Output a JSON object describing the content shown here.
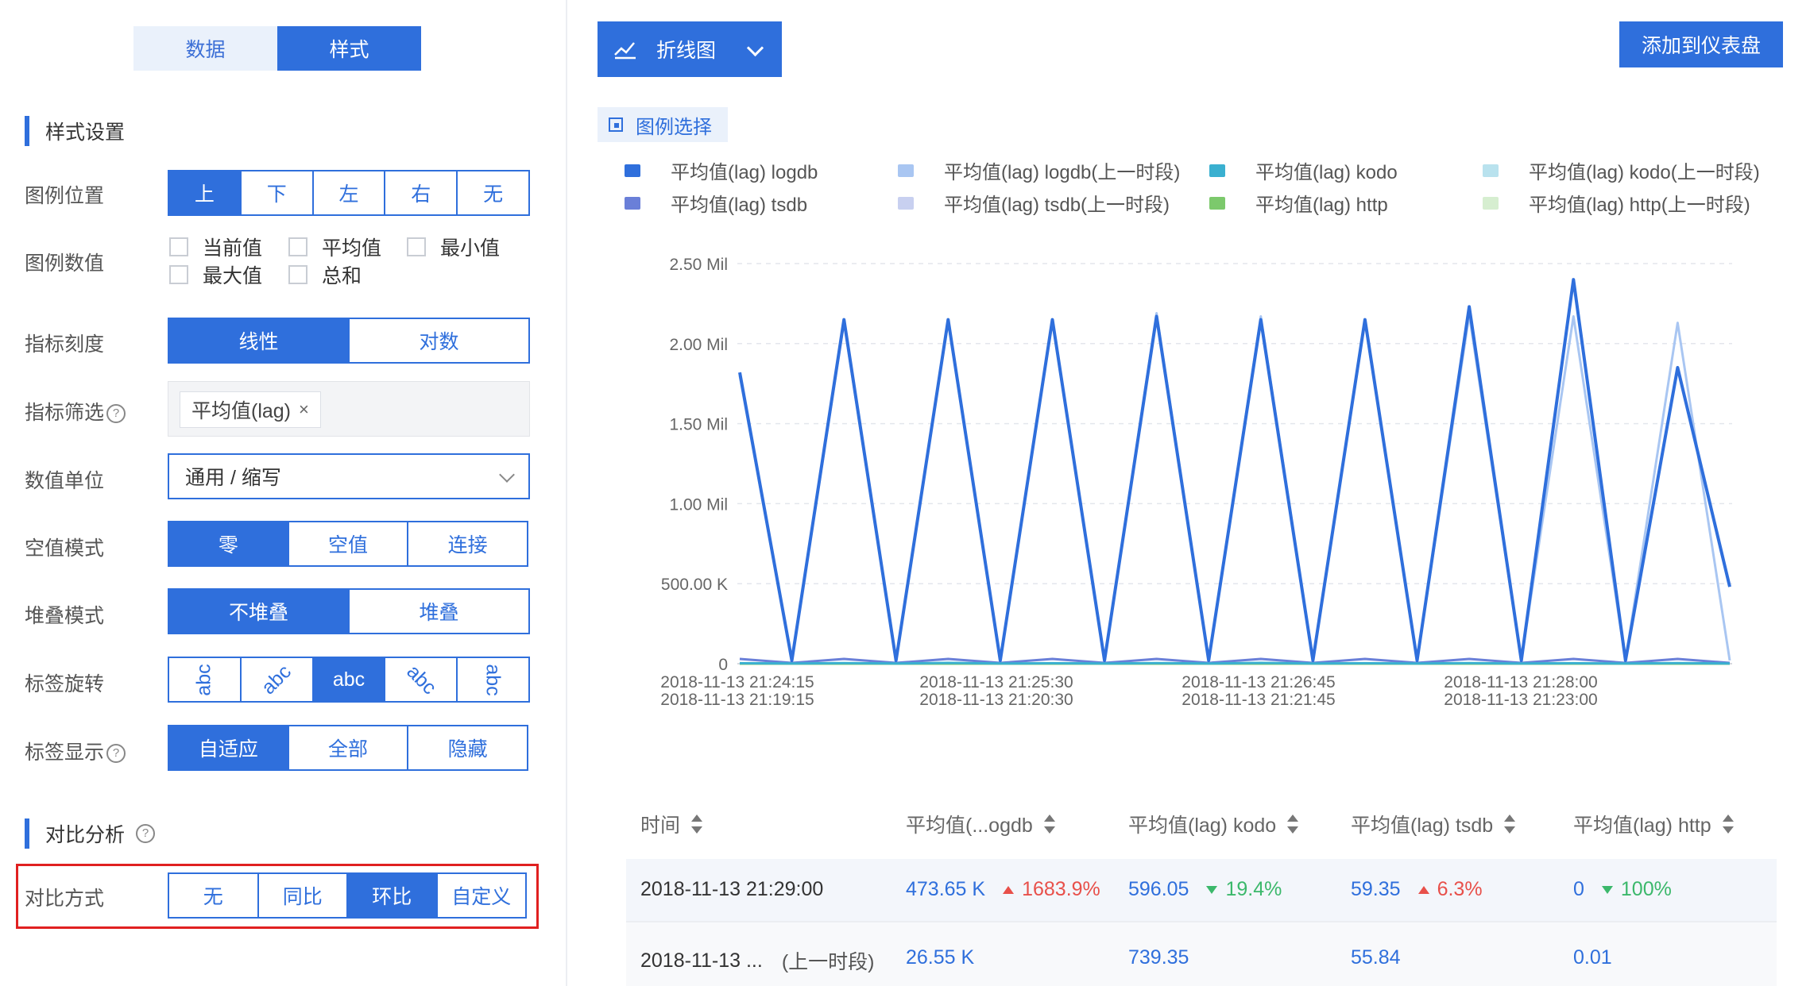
{
  "tabs": {
    "data": "数据",
    "style": "样式"
  },
  "style_section": {
    "title": "样式设置",
    "legend_position": {
      "label": "图例位置",
      "options": [
        "上",
        "下",
        "左",
        "右",
        "无"
      ],
      "selected": "上"
    },
    "legend_values": {
      "label": "图例数值",
      "options": [
        "当前值",
        "平均值",
        "最小值",
        "最大值",
        "总和"
      ]
    },
    "scale": {
      "label": "指标刻度",
      "options": [
        "线性",
        "对数"
      ],
      "selected": "线性"
    },
    "metric_filter": {
      "label": "指标筛选",
      "tag": "平均值(lag)",
      "tag_remove": "×"
    },
    "unit": {
      "label": "数值单位",
      "value": "通用 / 缩写"
    },
    "null_mode": {
      "label": "空值模式",
      "options": [
        "零",
        "空值",
        "连接"
      ],
      "selected": "零"
    },
    "stack_mode": {
      "label": "堆叠模式",
      "options": [
        "不堆叠",
        "堆叠"
      ],
      "selected": "不堆叠"
    },
    "label_rotate": {
      "label": "标签旋转",
      "options": [
        "abc",
        "abc",
        "abc",
        "abc",
        "abc"
      ],
      "selected_index": 2
    },
    "label_display": {
      "label": "标签显示",
      "options": [
        "自适应",
        "全部",
        "隐藏"
      ],
      "selected": "自适应"
    }
  },
  "compare_section": {
    "title": "对比分析",
    "mode": {
      "label": "对比方式",
      "options": [
        "无",
        "同比",
        "环比",
        "自定义"
      ],
      "selected": "环比"
    }
  },
  "help_glyph": "?",
  "toolbar": {
    "chart_type": "折线图",
    "add_button": "添加到仪表盘",
    "legend_select": "图例选择"
  },
  "legend": [
    {
      "label": "平均值(lag) logdb",
      "color": "#2f6fdc"
    },
    {
      "label": "平均值(lag) logdb(上一时段)",
      "color": "#a9c6f2"
    },
    {
      "label": "平均值(lag) kodo",
      "color": "#3ab0d0"
    },
    {
      "label": "平均值(lag) kodo(上一时段)",
      "color": "#b9e2ee"
    },
    {
      "label": "平均值(lag) tsdb",
      "color": "#6a7fd8"
    },
    {
      "label": "平均值(lag) tsdb(上一时段)",
      "color": "#c8d0f0"
    },
    {
      "label": "平均值(lag) http",
      "color": "#7cc96c"
    },
    {
      "label": "平均值(lag) http(上一时段)",
      "color": "#d6eed0"
    }
  ],
  "chart_data": {
    "type": "line",
    "y_ticks": [
      "2.50 Mil",
      "2.00 Mil",
      "1.50 Mil",
      "1.00 Mil",
      "500.00 K",
      "0"
    ],
    "ylim": [
      0,
      2500000
    ],
    "x_ticks": [
      {
        "top": "2018-11-13 21:24:15",
        "bottom": "2018-11-13 21:19:15"
      },
      {
        "top": "2018-11-13 21:25:30",
        "bottom": "2018-11-13 21:20:30"
      },
      {
        "top": "2018-11-13 21:26:45",
        "bottom": "2018-11-13 21:21:45"
      },
      {
        "top": "2018-11-13 21:28:00",
        "bottom": "2018-11-13 21:23:00"
      }
    ],
    "series": [
      {
        "name": "平均值(lag) logdb",
        "color": "#2f6fdc",
        "values": [
          1820000,
          20000,
          2150000,
          20000,
          2150000,
          20000,
          2150000,
          20000,
          2170000,
          20000,
          2150000,
          20000,
          2150000,
          20000,
          2230000,
          20000,
          2400000,
          20000,
          1850000,
          480000
        ]
      },
      {
        "name": "平均值(lag) logdb(上一时段)",
        "color": "#a9c6f2",
        "values": [
          1800000,
          20000,
          2130000,
          20000,
          2140000,
          20000,
          2140000,
          20000,
          2190000,
          20000,
          2170000,
          20000,
          2140000,
          20000,
          2180000,
          20000,
          2170000,
          20000,
          2130000,
          20000
        ]
      },
      {
        "name": "平均值(lag) kodo",
        "color": "#3ab0d0",
        "values": [
          3000,
          1000,
          4000,
          1000,
          5000,
          1000,
          3000,
          1000,
          4000,
          1000,
          5000,
          1000,
          3000,
          1000,
          4000,
          1000,
          3000,
          1000,
          4000,
          1000
        ]
      },
      {
        "name": "平均值(lag) tsdb",
        "color": "#6a7fd8",
        "values": [
          30000,
          5000,
          30000,
          5000,
          30000,
          5000,
          30000,
          5000,
          30000,
          5000,
          30000,
          5000,
          30000,
          5000,
          30000,
          5000,
          30000,
          5000,
          30000,
          5000
        ]
      },
      {
        "name": "平均值(lag) http",
        "color": "#7cc96c",
        "values": [
          0,
          0,
          0,
          0,
          0,
          0,
          0,
          0,
          0,
          0,
          0,
          0,
          0,
          0,
          0,
          0,
          0,
          0,
          0,
          0
        ]
      }
    ]
  },
  "table": {
    "headers": [
      "时间",
      "平均值(...ogdb",
      "平均值(lag) kodo",
      "平均值(lag) tsdb",
      "平均值(lag) http"
    ],
    "row1": {
      "time": "2018-11-13 21:29:00",
      "logdb": "473.65 K",
      "logdb_change": "1683.9%",
      "kodo": "596.05",
      "kodo_change": "19.4%",
      "tsdb": "59.35",
      "tsdb_change": "6.3%",
      "http": "0",
      "http_change": "100%"
    },
    "row2": {
      "time": "2018-11-13 ...",
      "period": "(上一时段)",
      "logdb": "26.55 K",
      "kodo": "739.35",
      "tsdb": "55.84",
      "http": "0.01"
    }
  }
}
